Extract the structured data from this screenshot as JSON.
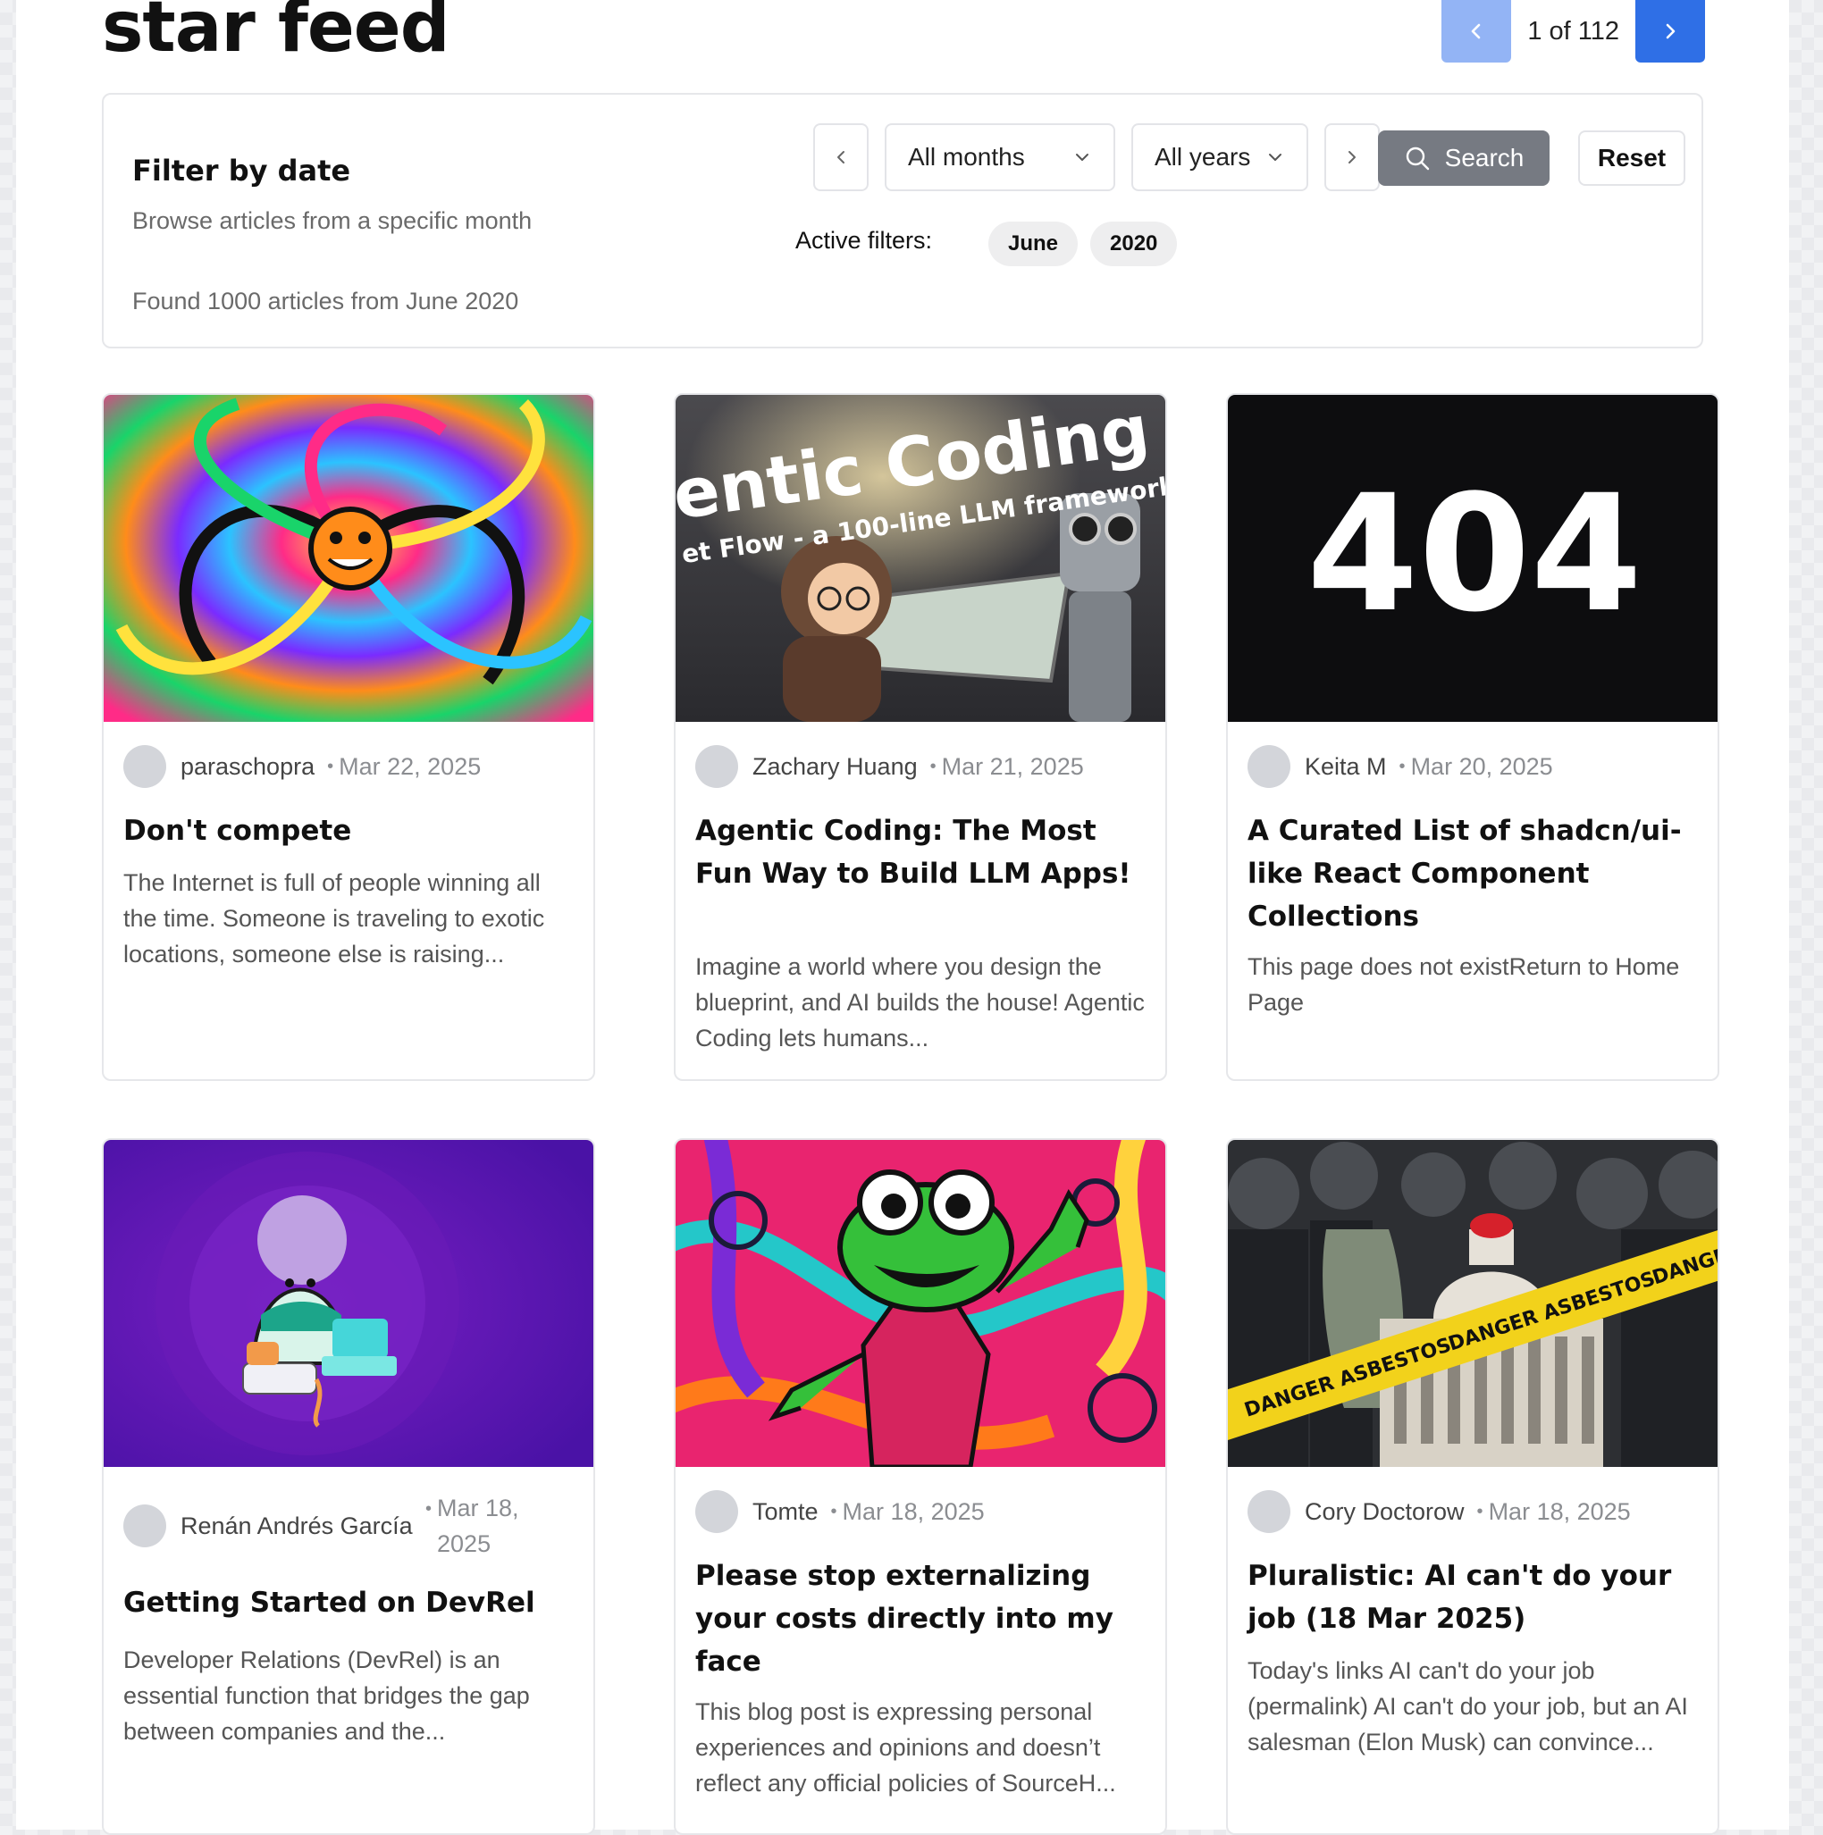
{
  "header": {
    "title": "star feed",
    "pager": {
      "text": "1 of 112"
    }
  },
  "filter": {
    "title": "Filter by date",
    "subtitle": "Browse articles from a specific month",
    "found": "Found 1000 articles from June 2020",
    "month": {
      "value": "All months"
    },
    "year": {
      "value": "All years"
    },
    "search_label": "Search",
    "reset_label": "Reset",
    "active_label": "Active filters:",
    "chips": [
      "June",
      "2020"
    ]
  },
  "colors": {
    "accent": "#2f6fe6",
    "accent_light": "#93b4f5",
    "search_bg": "#767a82"
  },
  "articles": [
    {
      "author": "paraschopra",
      "date": "Mar 22, 2025",
      "title": "Don't compete",
      "desc": "The Internet is full of people winning all the time. Someone is traveling to exotic locations, someone else is raising..."
    },
    {
      "author": "Zachary Huang",
      "date": "Mar 21, 2025",
      "title": "Agentic Coding: The Most Fun Way to Build LLM Apps!",
      "desc": "Imagine a world where you design the blueprint, and AI builds the house! Agentic Coding lets humans...",
      "image_text": {
        "line1": "entic Coding",
        "line2": "et Flow - a 100-line LLM framework"
      }
    },
    {
      "author": "Keita M",
      "date": "Mar 20, 2025",
      "title": "A Curated List of shadcn/ui-like React Component Collections",
      "desc": "This page does not existReturn to Home Page",
      "image_text": {
        "big": "404"
      }
    },
    {
      "author": "Renán Andrés García",
      "date": "Mar 18, 2025",
      "title": "Getting Started on DevRel",
      "desc": "Developer Relations (DevRel) is an essential function that bridges the gap between companies and the..."
    },
    {
      "author": "Tomte",
      "date": "Mar 18, 2025",
      "title": "Please stop externalizing your costs directly into my face",
      "desc": "This blog post is expressing personal experiences and opinions and doesn’t reflect any official policies of SourceH..."
    },
    {
      "author": "Cory Doctorow",
      "date": "Mar 18, 2025",
      "title": "Pluralistic: AI can't do your job (18 Mar 2025)",
      "desc": "Today's links AI can't do your job (permalink) AI can't do your job, but an AI salesman (Elon Musk) can convince...",
      "image_text": {
        "tape": "DANGER ASBESTOS"
      }
    }
  ]
}
